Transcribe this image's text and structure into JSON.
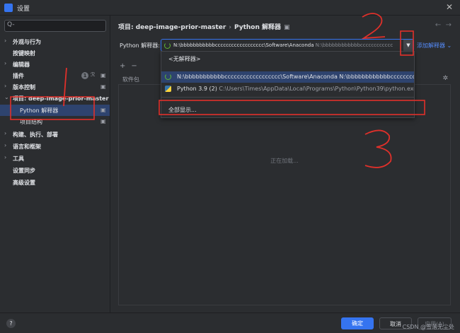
{
  "window": {
    "title": "设置"
  },
  "sidebar": {
    "search_placeholder": "Q-",
    "items": [
      {
        "chevron": "›",
        "label": "外观与行为"
      },
      {
        "chevron": "",
        "label": "按键映射"
      },
      {
        "chevron": "›",
        "label": "编辑器"
      },
      {
        "chevron": "",
        "label": "插件",
        "badge": "1"
      },
      {
        "chevron": "›",
        "label": "版本控制"
      },
      {
        "chevron": "⌄",
        "label": "项目: deep-image-prior-master"
      },
      {
        "chevron": "",
        "label": "Python 解释器"
      },
      {
        "chevron": "",
        "label": "项目结构"
      },
      {
        "chevron": "›",
        "label": "构建、执行、部署"
      },
      {
        "chevron": "›",
        "label": "语言和框架"
      },
      {
        "chevron": "›",
        "label": "工具"
      },
      {
        "chevron": "",
        "label": "设置同步"
      },
      {
        "chevron": "",
        "label": "高级设置"
      }
    ]
  },
  "main": {
    "breadcrumb": {
      "project": "项目: deep-image-prior-master",
      "page": "Python 解释器"
    },
    "interpreter_label": "Python 解释器:",
    "interpreter_value": "N:\\bbbbbbbbbbbcccccccccccccccccc\\Software\\Anaconda",
    "interpreter_value_dim": "N:\\bbbbbbbbbbbbcccccccccccc",
    "add_interpreter": "添加解释器",
    "packages_header": "软件包",
    "loading_text": "正在加载..."
  },
  "dropdown": {
    "no_interpreter": "<无解释器>",
    "option1": "N:\\bbbbbbbbbbbcccccccccccccccccc\\Software\\Anaconda",
    "option1_dim": "N:\\bbbbbbbbbbbbcccccccccccccccc",
    "option2": "Python 3.9 (2)",
    "option2_dim": "C:\\Users\\Times\\AppData\\Local\\Programs\\Python\\Python39\\python.exe",
    "show_all": "全部显示..."
  },
  "footer": {
    "help": "?",
    "ok": "确定",
    "cancel": "取消",
    "apply": "应用(A)"
  },
  "watermark": "CSDN @雪落无尘处",
  "annotations": {
    "n1": "1",
    "n2": "2",
    "n3": "3"
  },
  "colors": {
    "accent": "#3574f0",
    "selection": "#2e436e",
    "annotation": "#e0302a"
  }
}
